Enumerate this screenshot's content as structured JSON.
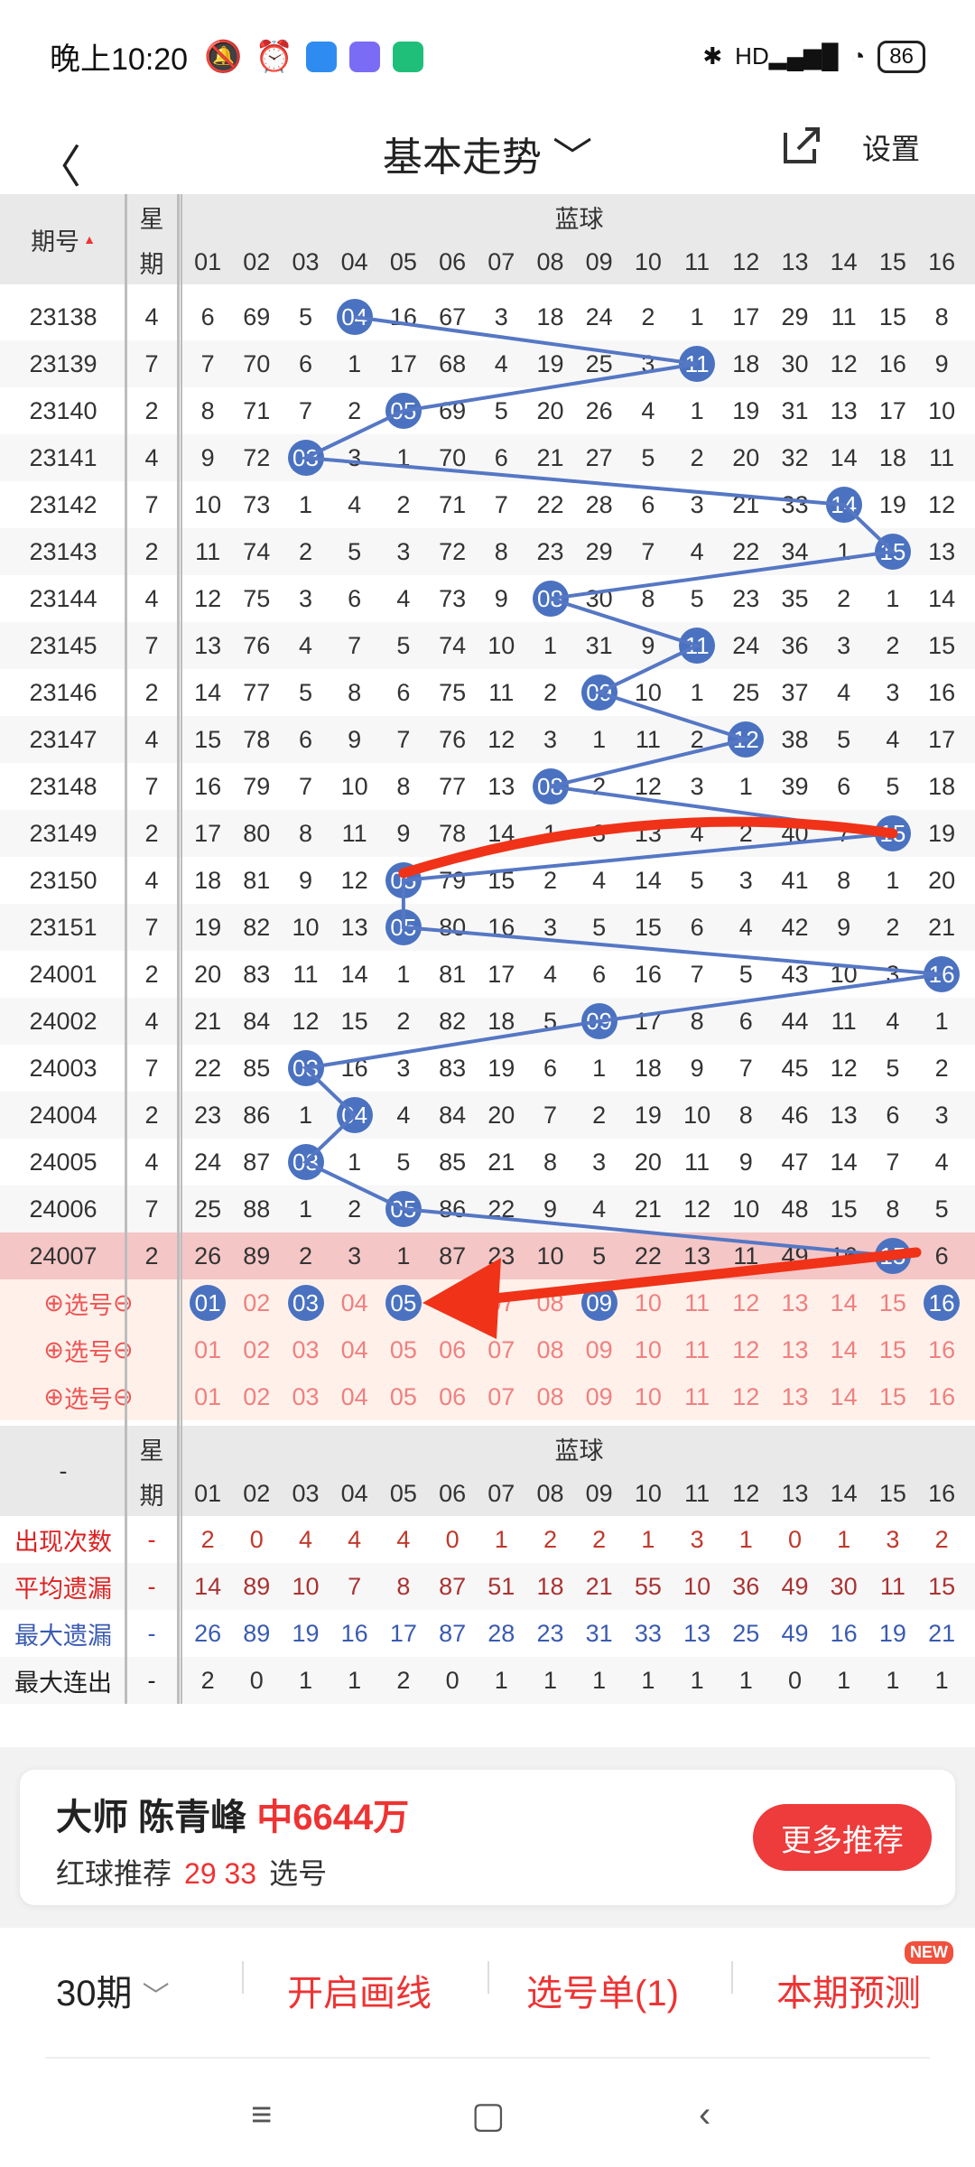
{
  "status": {
    "time": "晚上10:20",
    "battery": "86",
    "hd": "HD"
  },
  "header": {
    "title": "基本走势",
    "settings": "设置"
  },
  "table": {
    "col_issue": "期号",
    "col_week_top": "星",
    "col_week_bot": "期",
    "col_blue": "蓝球",
    "numbers": [
      "01",
      "02",
      "03",
      "04",
      "05",
      "06",
      "07",
      "08",
      "09",
      "10",
      "11",
      "12",
      "13",
      "14",
      "15",
      "16"
    ],
    "rows": [
      {
        "issue": "23138",
        "week": "4",
        "vals": [
          "6",
          "69",
          "5",
          "04",
          "16",
          "67",
          "3",
          "18",
          "24",
          "2",
          "1",
          "17",
          "29",
          "11",
          "15",
          "8"
        ],
        "hit": 4
      },
      {
        "issue": "23139",
        "week": "7",
        "vals": [
          "7",
          "70",
          "6",
          "1",
          "17",
          "68",
          "4",
          "19",
          "25",
          "3",
          "11",
          "18",
          "30",
          "12",
          "16",
          "9"
        ],
        "hit": 11
      },
      {
        "issue": "23140",
        "week": "2",
        "vals": [
          "8",
          "71",
          "7",
          "2",
          "05",
          "69",
          "5",
          "20",
          "26",
          "4",
          "1",
          "19",
          "31",
          "13",
          "17",
          "10"
        ],
        "hit": 5
      },
      {
        "issue": "23141",
        "week": "4",
        "vals": [
          "9",
          "72",
          "03",
          "3",
          "1",
          "70",
          "6",
          "21",
          "27",
          "5",
          "2",
          "20",
          "32",
          "14",
          "18",
          "11"
        ],
        "hit": 3
      },
      {
        "issue": "23142",
        "week": "7",
        "vals": [
          "10",
          "73",
          "1",
          "4",
          "2",
          "71",
          "7",
          "22",
          "28",
          "6",
          "3",
          "21",
          "33",
          "14",
          "19",
          "12"
        ],
        "hit": 14
      },
      {
        "issue": "23143",
        "week": "2",
        "vals": [
          "11",
          "74",
          "2",
          "5",
          "3",
          "72",
          "8",
          "23",
          "29",
          "7",
          "4",
          "22",
          "34",
          "1",
          "15",
          "13"
        ],
        "hit": 15
      },
      {
        "issue": "23144",
        "week": "4",
        "vals": [
          "12",
          "75",
          "3",
          "6",
          "4",
          "73",
          "9",
          "08",
          "30",
          "8",
          "5",
          "23",
          "35",
          "2",
          "1",
          "14"
        ],
        "hit": 8
      },
      {
        "issue": "23145",
        "week": "7",
        "vals": [
          "13",
          "76",
          "4",
          "7",
          "5",
          "74",
          "10",
          "1",
          "31",
          "9",
          "11",
          "24",
          "36",
          "3",
          "2",
          "15"
        ],
        "hit": 11
      },
      {
        "issue": "23146",
        "week": "2",
        "vals": [
          "14",
          "77",
          "5",
          "8",
          "6",
          "75",
          "11",
          "2",
          "09",
          "10",
          "1",
          "25",
          "37",
          "4",
          "3",
          "16"
        ],
        "hit": 9
      },
      {
        "issue": "23147",
        "week": "4",
        "vals": [
          "15",
          "78",
          "6",
          "9",
          "7",
          "76",
          "12",
          "3",
          "1",
          "11",
          "2",
          "12",
          "38",
          "5",
          "4",
          "17"
        ],
        "hit": 12
      },
      {
        "issue": "23148",
        "week": "7",
        "vals": [
          "16",
          "79",
          "7",
          "10",
          "8",
          "77",
          "13",
          "08",
          "2",
          "12",
          "3",
          "1",
          "39",
          "6",
          "5",
          "18"
        ],
        "hit": 8
      },
      {
        "issue": "23149",
        "week": "2",
        "vals": [
          "17",
          "80",
          "8",
          "11",
          "9",
          "78",
          "14",
          "1",
          "3",
          "13",
          "4",
          "2",
          "40",
          "7",
          "15",
          "19"
        ],
        "hit": 15
      },
      {
        "issue": "23150",
        "week": "4",
        "vals": [
          "18",
          "81",
          "9",
          "12",
          "05",
          "79",
          "15",
          "2",
          "4",
          "14",
          "5",
          "3",
          "41",
          "8",
          "1",
          "20"
        ],
        "hit": 5
      },
      {
        "issue": "23151",
        "week": "7",
        "vals": [
          "19",
          "82",
          "10",
          "13",
          "05",
          "80",
          "16",
          "3",
          "5",
          "15",
          "6",
          "4",
          "42",
          "9",
          "2",
          "21"
        ],
        "hit": 5
      },
      {
        "issue": "24001",
        "week": "2",
        "vals": [
          "20",
          "83",
          "11",
          "14",
          "1",
          "81",
          "17",
          "4",
          "6",
          "16",
          "7",
          "5",
          "43",
          "10",
          "3",
          "16"
        ],
        "hit": 16
      },
      {
        "issue": "24002",
        "week": "4",
        "vals": [
          "21",
          "84",
          "12",
          "15",
          "2",
          "82",
          "18",
          "5",
          "09",
          "17",
          "8",
          "6",
          "44",
          "11",
          "4",
          "1"
        ],
        "hit": 9
      },
      {
        "issue": "24003",
        "week": "7",
        "vals": [
          "22",
          "85",
          "03",
          "16",
          "3",
          "83",
          "19",
          "6",
          "1",
          "18",
          "9",
          "7",
          "45",
          "12",
          "5",
          "2"
        ],
        "hit": 3
      },
      {
        "issue": "24004",
        "week": "2",
        "vals": [
          "23",
          "86",
          "1",
          "04",
          "4",
          "84",
          "20",
          "7",
          "2",
          "19",
          "10",
          "8",
          "46",
          "13",
          "6",
          "3"
        ],
        "hit": 4
      },
      {
        "issue": "24005",
        "week": "4",
        "vals": [
          "24",
          "87",
          "03",
          "1",
          "5",
          "85",
          "21",
          "8",
          "3",
          "20",
          "11",
          "9",
          "47",
          "14",
          "7",
          "4"
        ],
        "hit": 3
      },
      {
        "issue": "24006",
        "week": "7",
        "vals": [
          "25",
          "88",
          "1",
          "2",
          "05",
          "86",
          "22",
          "9",
          "4",
          "21",
          "12",
          "10",
          "48",
          "15",
          "8",
          "5"
        ],
        "hit": 5
      },
      {
        "issue": "24007",
        "week": "2",
        "vals": [
          "26",
          "89",
          "2",
          "3",
          "1",
          "87",
          "23",
          "10",
          "5",
          "22",
          "13",
          "11",
          "49",
          "16",
          "15",
          "6"
        ],
        "hit": 15
      }
    ],
    "select_label": "选号",
    "selected": [
      1,
      3,
      5,
      9,
      16
    ]
  },
  "stats": {
    "labels": [
      "出现次数",
      "平均遗漏",
      "最大遗漏",
      "最大连出"
    ],
    "dash": "-",
    "appear": [
      "2",
      "0",
      "4",
      "4",
      "4",
      "0",
      "1",
      "2",
      "2",
      "1",
      "3",
      "1",
      "0",
      "1",
      "3",
      "2"
    ],
    "avg": [
      "14",
      "89",
      "10",
      "7",
      "8",
      "87",
      "51",
      "18",
      "21",
      "55",
      "10",
      "36",
      "49",
      "30",
      "11",
      "15"
    ],
    "max_miss": [
      "26",
      "89",
      "19",
      "16",
      "17",
      "87",
      "28",
      "23",
      "31",
      "33",
      "13",
      "25",
      "49",
      "16",
      "19",
      "21"
    ],
    "max_run": [
      "2",
      "0",
      "1",
      "1",
      "2",
      "0",
      "1",
      "1",
      "1",
      "1",
      "1",
      "1",
      "0",
      "1",
      "1",
      "1"
    ]
  },
  "card": {
    "title": "大师 陈青峰",
    "prize": "中6644万",
    "rec_label": "红球推荐",
    "rec_nums": "29 33",
    "rec_suffix": "选号",
    "more": "更多推荐"
  },
  "bottom": {
    "period": "30期",
    "draw": "开启画线",
    "cart": "选号单(1)",
    "predict": "本期预测",
    "new": "NEW"
  },
  "colors": {
    "ball": "#4a72c0",
    "accent": "#e33",
    "arrow": "#f03218"
  }
}
